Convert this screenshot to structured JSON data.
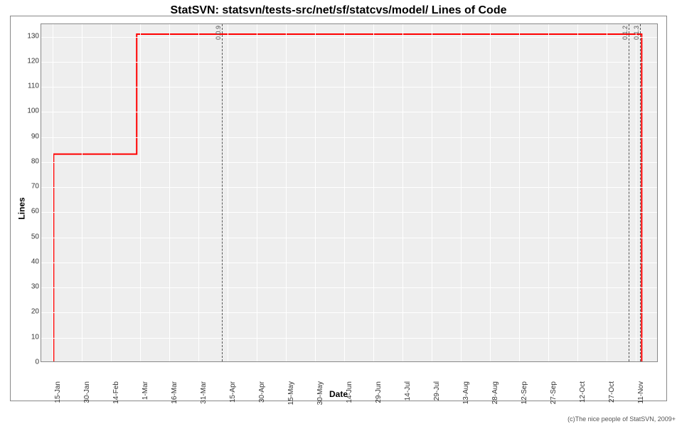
{
  "chart_data": {
    "type": "line",
    "title": "StatSVN: statsvn/tests-src/net/sf/statcvs/model/ Lines of Code",
    "xlabel": "Date",
    "ylabel": "Lines",
    "ylim": [
      0,
      135
    ],
    "y_ticks": [
      0,
      10,
      20,
      30,
      40,
      50,
      60,
      70,
      80,
      90,
      100,
      110,
      120,
      130
    ],
    "x_categories": [
      "15-Jan",
      "30-Jan",
      "14-Feb",
      "1-Mar",
      "16-Mar",
      "31-Mar",
      "15-Apr",
      "30-Apr",
      "15-May",
      "30-May",
      "14-Jun",
      "29-Jun",
      "14-Jul",
      "29-Jul",
      "13-Aug",
      "28-Aug",
      "12-Sep",
      "27-Sep",
      "12-Oct",
      "27-Oct",
      "11-Nov"
    ],
    "series": [
      {
        "name": "Lines of Code",
        "color": "#ff0000",
        "points": [
          {
            "x_frac": 0.02,
            "y": 0
          },
          {
            "x_frac": 0.02,
            "y": 83
          },
          {
            "x_frac": 0.155,
            "y": 83
          },
          {
            "x_frac": 0.155,
            "y": 131
          },
          {
            "x_frac": 0.975,
            "y": 131
          },
          {
            "x_frac": 0.975,
            "y": 0
          }
        ]
      }
    ],
    "reference_lines": [
      {
        "x_frac": 0.293,
        "label": "0.0.9"
      },
      {
        "x_frac": 0.952,
        "label": "0.1.2"
      },
      {
        "x_frac": 0.97,
        "label": "0.1.3"
      }
    ],
    "footer": "(c)The nice people of StatSVN, 2009+"
  }
}
